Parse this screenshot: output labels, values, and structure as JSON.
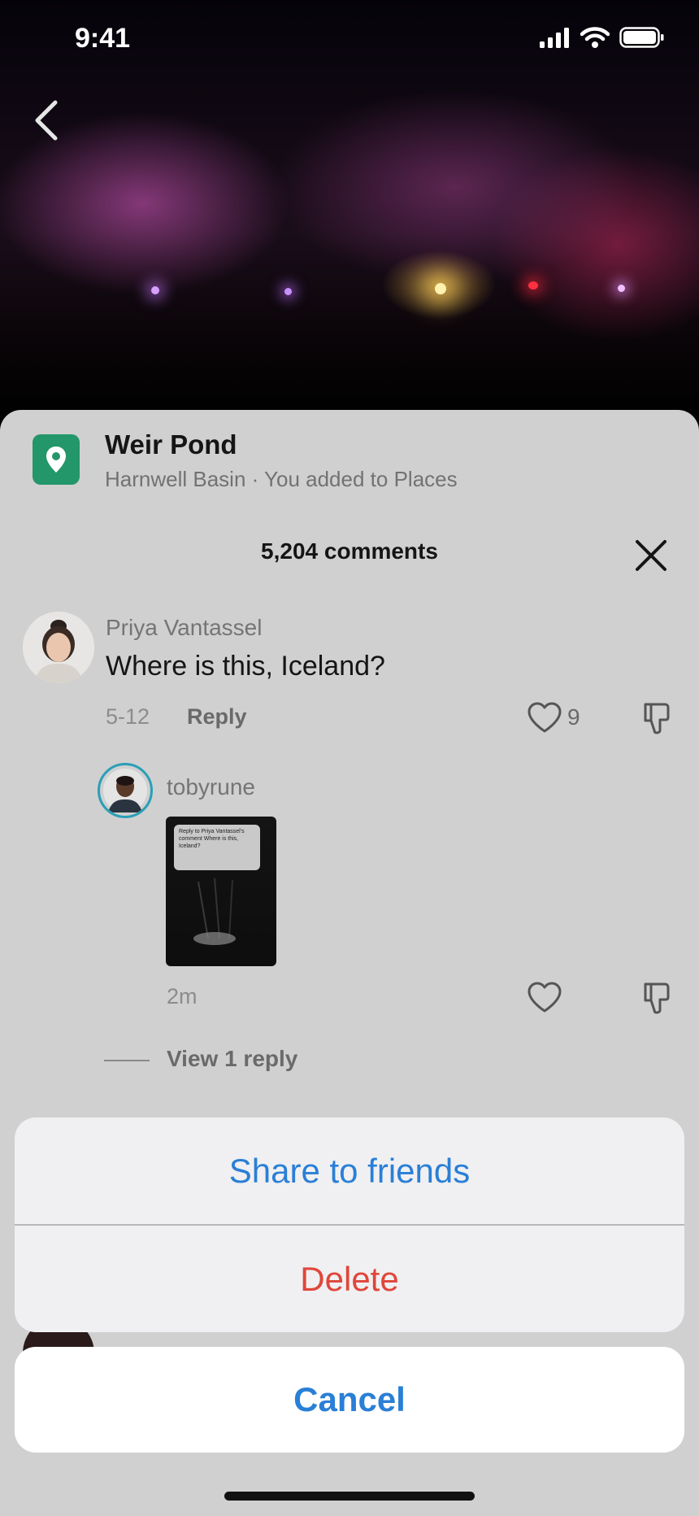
{
  "status_bar": {
    "time": "9:41"
  },
  "place": {
    "name": "Weir Pond",
    "subtitle": "Harnwell Basin · You added to Places"
  },
  "comments_header": {
    "count_label": "5,204 comments"
  },
  "comment": {
    "author": "Priya Vantassel",
    "text": "Where is this, Iceland?",
    "date": "5-12",
    "reply_label": "Reply",
    "like_count": "9"
  },
  "reply": {
    "author": "tobyrune",
    "thumbnail_card_text": "Reply to Priya Vantassel's comment Where is this, Iceland?",
    "time": "2m"
  },
  "view_replies_label": "View 1 reply",
  "action_sheet": {
    "share_label": "Share to friends",
    "delete_label": "Delete",
    "cancel_label": "Cancel"
  },
  "colors": {
    "accent_blue": "#2a7fd6",
    "destructive_red": "#e0463a",
    "pin_green": "#23966a",
    "sheet_gray": "#d0d0d0"
  },
  "icons": {
    "back": "chevron-left-icon",
    "pin": "location-pin-icon",
    "close": "close-icon",
    "like": "heart-icon",
    "dislike": "thumbs-down-icon"
  }
}
